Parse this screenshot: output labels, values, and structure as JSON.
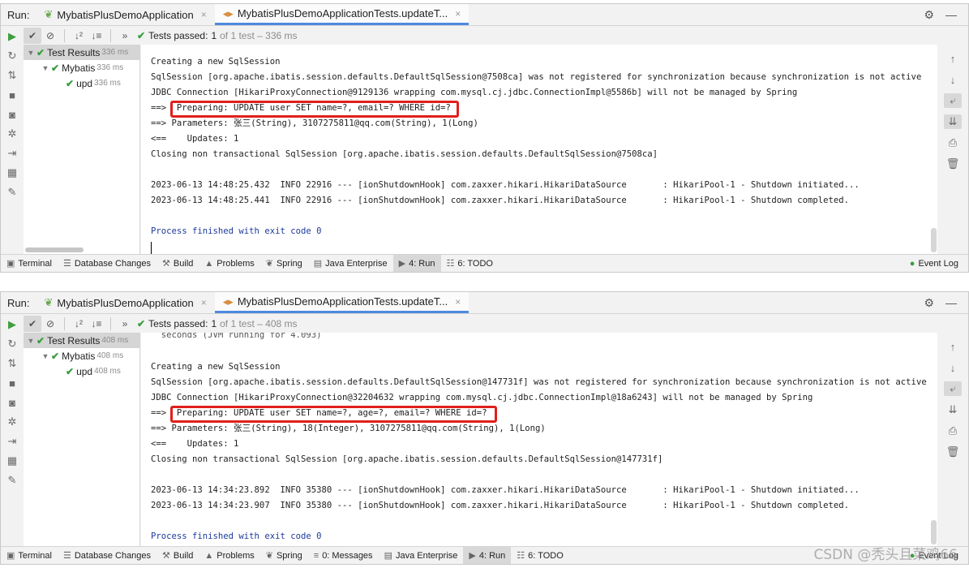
{
  "panels": [
    {
      "run_label": "Run:",
      "tabs": [
        {
          "label": "MybatisPlusDemoApplication",
          "close": "×"
        },
        {
          "label": "MybatisPlusDemoApplicationTests.updateT...",
          "close": "×"
        }
      ],
      "toolbar": {
        "chevron": "»",
        "tests_prefix": "Tests passed:",
        "tests_count": "1",
        "tests_suffix": "of 1 test – 336 ms"
      },
      "tree": [
        {
          "label": "Test Results",
          "time": "336 ms"
        },
        {
          "label": "Mybatis",
          "time": "336 ms"
        },
        {
          "label": "upd",
          "time": "336 ms"
        }
      ],
      "console": [
        "Creating a new SqlSession",
        "SqlSession [org.apache.ibatis.session.defaults.DefaultSqlSession@7508ca] was not registered for synchronization because synchronization is not active",
        "JDBC Connection [HikariProxyConnection@9129136 wrapping com.mysql.cj.jdbc.ConnectionImpl@5586b] will not be managed by Spring",
        "==>  Preparing: UPDATE user SET name=?, email=? WHERE id=?",
        "==> Parameters: 张三(String), 3107275811@qq.com(String), 1(Long)",
        "<==    Updates: 1",
        "Closing non transactional SqlSession [org.apache.ibatis.session.defaults.DefaultSqlSession@7508ca]",
        "",
        "2023-06-13 14:48:25.432  INFO 22916 --- [ionShutdownHook] com.zaxxer.hikari.HikariDataSource       : HikariPool-1 - Shutdown initiated...",
        "2023-06-13 14:48:25.441  INFO 22916 --- [ionShutdownHook] com.zaxxer.hikari.HikariDataSource       : HikariPool-1 - Shutdown completed.",
        "",
        "Process finished with exit code 0"
      ],
      "statusbar": [
        "Terminal",
        "Database Changes",
        "Build",
        "Problems",
        "Spring",
        "Java Enterprise",
        "4: Run",
        "6: TODO"
      ],
      "event_log": "Event Log"
    },
    {
      "run_label": "Run:",
      "tabs": [
        {
          "label": "MybatisPlusDemoApplication",
          "close": "×"
        },
        {
          "label": "MybatisPlusDemoApplicationTests.updateT...",
          "close": "×"
        }
      ],
      "toolbar": {
        "chevron": "»",
        "tests_prefix": "Tests passed:",
        "tests_count": "1",
        "tests_suffix": "of 1 test – 408 ms"
      },
      "tree": [
        {
          "label": "Test Results",
          "time": "408 ms"
        },
        {
          "label": "Mybatis",
          "time": "408 ms"
        },
        {
          "label": "upd",
          "time": "408 ms"
        }
      ],
      "console_partial": "  seconds (JVM running for 4.093)",
      "console": [
        "Creating a new SqlSession",
        "SqlSession [org.apache.ibatis.session.defaults.DefaultSqlSession@147731f] was not registered for synchronization because synchronization is not active",
        "JDBC Connection [HikariProxyConnection@32204632 wrapping com.mysql.cj.jdbc.ConnectionImpl@18a6243] will not be managed by Spring",
        "==>  Preparing: UPDATE user SET name=?, age=?, email=? WHERE id=?",
        "==> Parameters: 张三(String), 18(Integer), 3107275811@qq.com(String), 1(Long)",
        "<==    Updates: 1",
        "Closing non transactional SqlSession [org.apache.ibatis.session.defaults.DefaultSqlSession@147731f]",
        "",
        "2023-06-13 14:34:23.892  INFO 35380 --- [ionShutdownHook] com.zaxxer.hikari.HikariDataSource       : HikariPool-1 - Shutdown initiated...",
        "2023-06-13 14:34:23.907  INFO 35380 --- [ionShutdownHook] com.zaxxer.hikari.HikariDataSource       : HikariPool-1 - Shutdown completed.",
        "",
        "Process finished with exit code 0"
      ],
      "statusbar": [
        "Terminal",
        "Database Changes",
        "Build",
        "Problems",
        "Spring",
        "0: Messages",
        "Java Enterprise",
        "4: Run",
        "6: TODO"
      ],
      "event_log": "Event Log"
    }
  ],
  "watermark": "CSDN @秃头且菜鸡66",
  "colors": {
    "accent_tab": "#4d8ae0",
    "pass_green": "#389e3b",
    "highlight_red": "#e0201b",
    "process_blue": "#1d3a9c"
  }
}
